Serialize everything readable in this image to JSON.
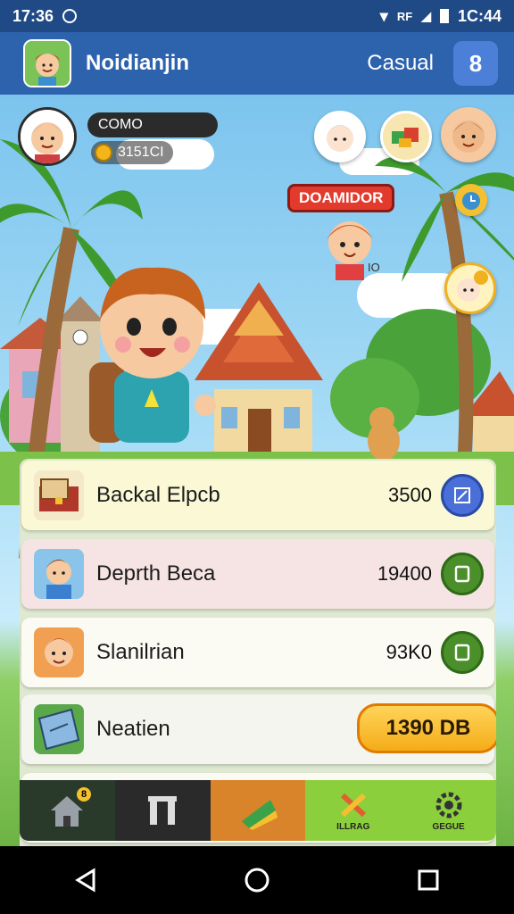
{
  "status_bar": {
    "time": "17:36",
    "clock_right": "1C:44",
    "indicator_text": "RF"
  },
  "app_bar": {
    "title": "Noidianjin",
    "category": "Casual",
    "badge": "8"
  },
  "player": {
    "name": "COMO",
    "coins": "3151CI"
  },
  "event_banner": {
    "label": "DOAMIDOR"
  },
  "scene_label": "IO",
  "shop_items": [
    {
      "name": "Backal Elpcb",
      "price": "3500",
      "action": "edit",
      "bg": "#fbf8d6"
    },
    {
      "name": "Deprth Beca",
      "price": "19400",
      "action": "confirm",
      "bg": "#f6e4e4"
    },
    {
      "name": "Slanilrian",
      "price": "93K0",
      "action": "confirm",
      "bg": "#fbfbf4"
    },
    {
      "name": "Neatien",
      "buy_label": "1390 DB",
      "bg": "#f5f5f0"
    }
  ],
  "bottom_nav": [
    {
      "icon": "home-icon",
      "label": "",
      "badge": "8"
    },
    {
      "icon": "gate-icon",
      "label": ""
    },
    {
      "icon": "flag-icon",
      "label": "",
      "active": true
    },
    {
      "icon": "tools-icon",
      "label": "ILLRAG"
    },
    {
      "icon": "gear-icon",
      "label": "GEGUE"
    }
  ],
  "colors": {
    "primary": "#2d62ad",
    "status": "#1f4a86",
    "accent_green": "#4a8f2a",
    "accent_gold": "#f5ac18",
    "nav_active": "#d9832a",
    "nav_bg": "#8ccf3c"
  }
}
